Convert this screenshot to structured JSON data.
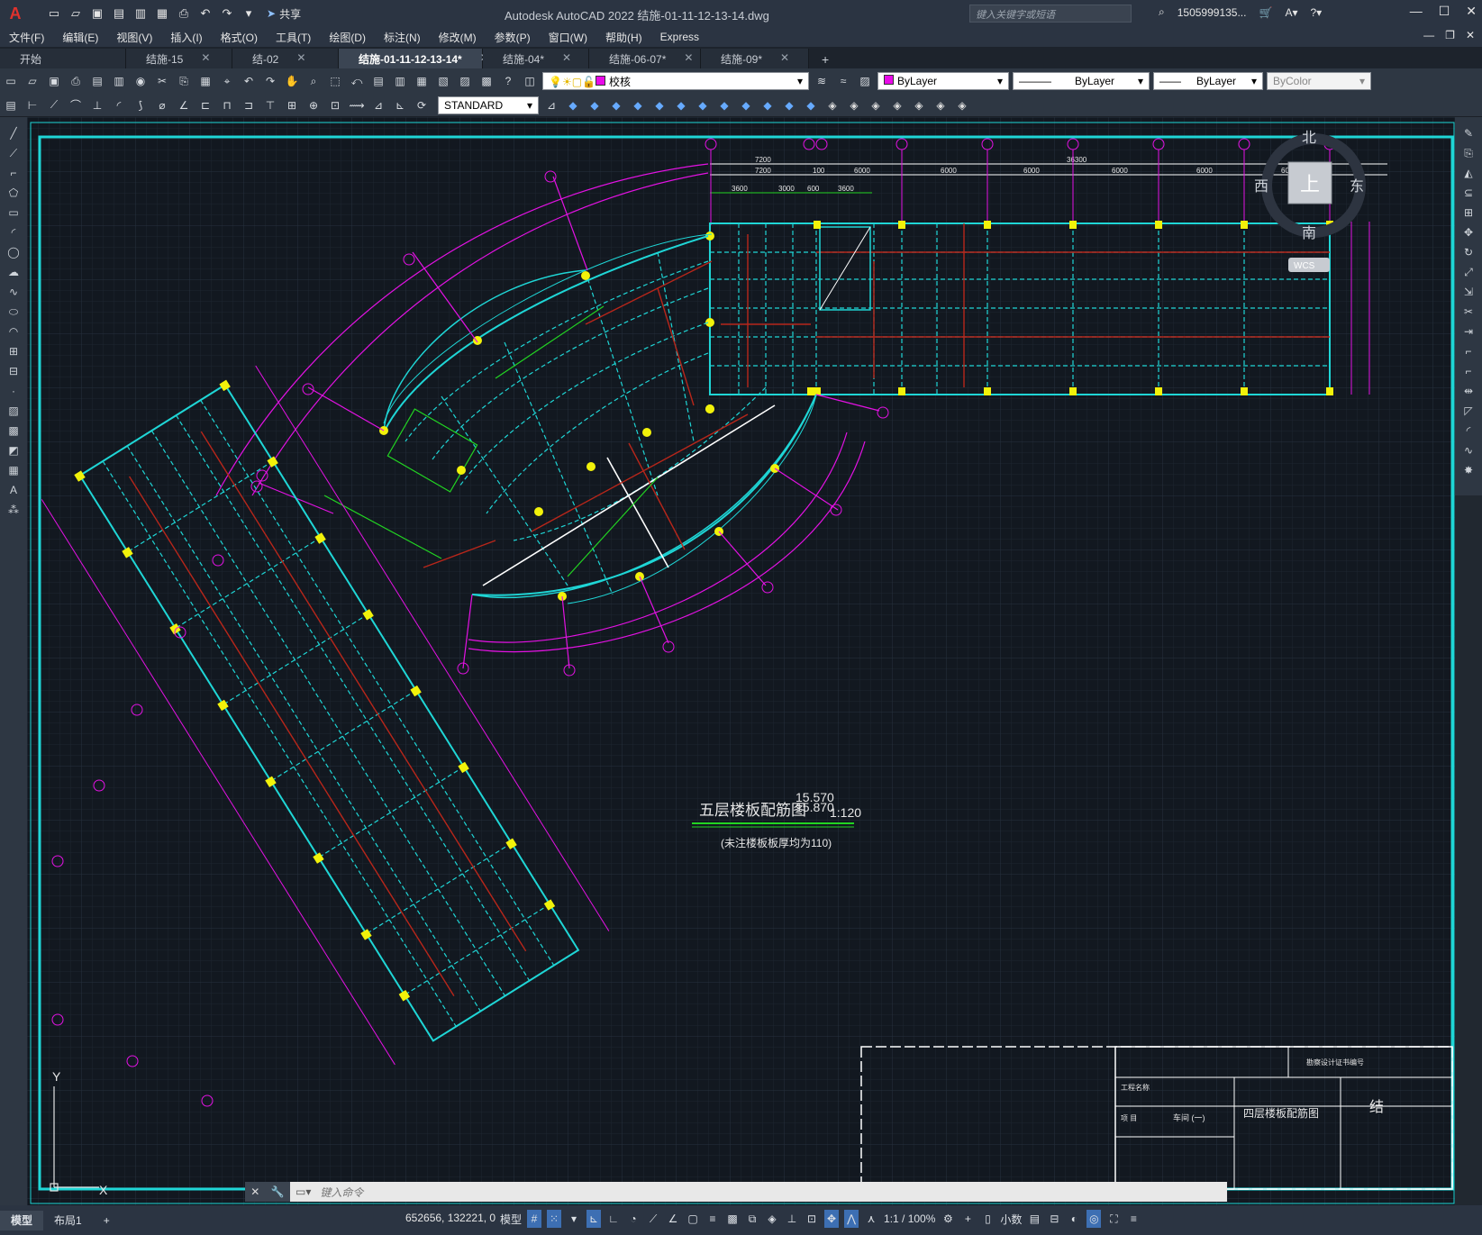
{
  "app": {
    "title": "Autodesk AutoCAD 2022    结施-01-11-12-13-14.dwg",
    "search_placeholder": "键入关键字或短语",
    "user": "1505999135...",
    "share_label": "共享"
  },
  "menu": [
    "文件(F)",
    "编辑(E)",
    "视图(V)",
    "插入(I)",
    "格式(O)",
    "工具(T)",
    "绘图(D)",
    "标注(N)",
    "修改(M)",
    "参数(P)",
    "窗口(W)",
    "帮助(H)",
    "Express"
  ],
  "tabs": [
    {
      "label": "开始",
      "closable": false
    },
    {
      "label": "结施-15",
      "closable": true
    },
    {
      "label": "结-02",
      "closable": true
    },
    {
      "label": "结施-01-11-12-13-14*",
      "closable": true,
      "active": true
    },
    {
      "label": "结施-04*",
      "closable": true
    },
    {
      "label": "结施-06-07*",
      "closable": true
    },
    {
      "label": "结施-09*",
      "closable": true
    }
  ],
  "toolbar": {
    "layer": "校核",
    "color": "ByLayer",
    "linetype": "ByLayer",
    "lineweight": "ByLayer",
    "plotstyle": "ByColor",
    "textstyle": "STANDARD"
  },
  "drawing": {
    "title": "五层楼板配筋图",
    "elev1": "15.570",
    "elev2": "15.870",
    "scale": "1:120",
    "note": "(未注楼板板厚均为110)",
    "titleblock_name": "四层楼板配筋图",
    "titleblock_row": "车间 (一)",
    "titleblock_unit": "工程名称",
    "titleblock_proj": "项 目",
    "titleblock_cert": "勘察设计证书编号",
    "titleblock_sheet": "结",
    "compass": {
      "n": "北",
      "s": "南",
      "e": "东",
      "w": "西",
      "center": "上",
      "wcs": "WCS"
    },
    "dims_top": [
      "7200",
      "7200",
      "100",
      "6000",
      "6000",
      "6000",
      "6000",
      "6000",
      "6000",
      "36300"
    ],
    "dims_sub": [
      "3600",
      "3000",
      "600",
      "3600"
    ],
    "axis_y": "Y",
    "axis_x": "X"
  },
  "command_placeholder": "键入命令",
  "layout_tabs": [
    "模型",
    "布局1"
  ],
  "status": {
    "coords": "652656, 132221, 0",
    "model": "模型",
    "scale": "1:1 / 100%",
    "units": "小数"
  },
  "colors": {
    "cyan": "#1fd6d6",
    "magenta": "#e312e3",
    "yellow": "#f2f20a",
    "red": "#b8261a",
    "green": "#22d422",
    "white": "#ffffff"
  }
}
